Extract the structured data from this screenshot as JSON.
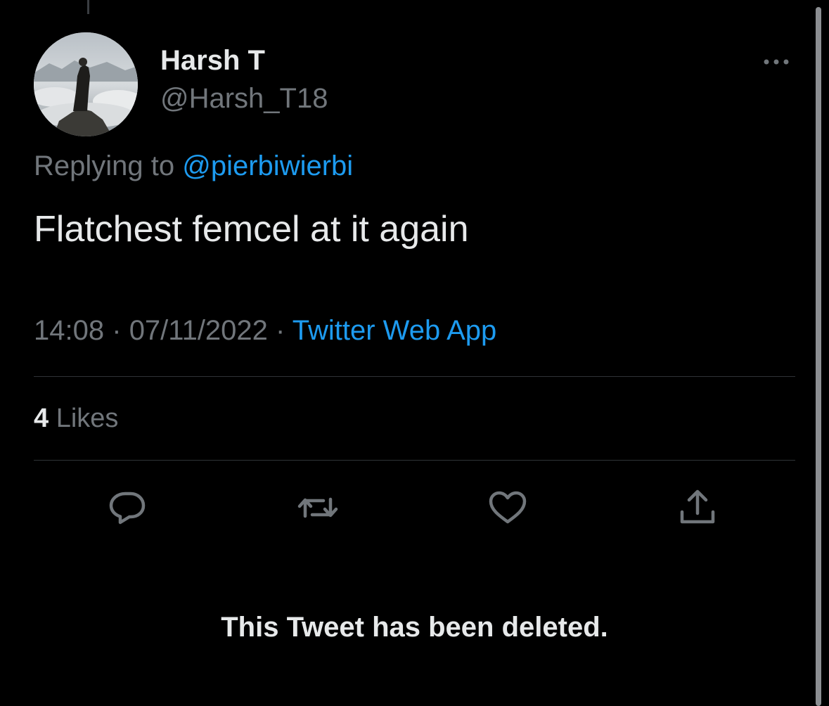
{
  "author": {
    "display_name": "Harsh T",
    "handle": "@Harsh_T18"
  },
  "reply": {
    "prefix": "Replying to",
    "mention": "@pierbiwierbi"
  },
  "tweet": {
    "text": "Flatchest femcel at it again"
  },
  "meta": {
    "time": "14:08",
    "separator": "·",
    "date": "07/11/2022",
    "source": "Twitter Web App"
  },
  "stats": {
    "likes_count": "4",
    "likes_label": "Likes"
  },
  "actions": {
    "icons": [
      "reply-icon",
      "retweet-icon",
      "like-icon",
      "share-icon"
    ]
  },
  "notice": {
    "deleted_text": "This Tweet has been deleted."
  },
  "colors": {
    "background": "#000000",
    "primary_text": "#e7e9ea",
    "secondary_text": "#71767b",
    "accent": "#1d9bf0",
    "divider": "#2f3336"
  }
}
